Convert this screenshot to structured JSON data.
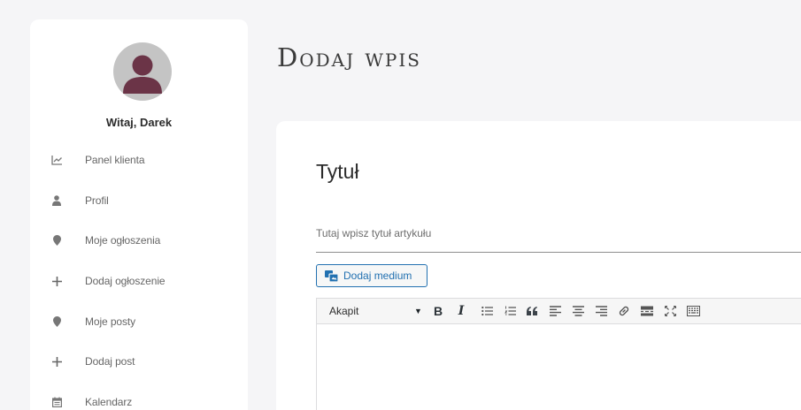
{
  "sidebar": {
    "greeting": "Witaj, Darek",
    "items": [
      {
        "label": "Panel klienta",
        "icon": "chart-line-icon"
      },
      {
        "label": "Profil",
        "icon": "user-icon"
      },
      {
        "label": "Moje ogłoszenia",
        "icon": "map-pin-icon"
      },
      {
        "label": "Dodaj ogłoszenie",
        "icon": "plus-icon"
      },
      {
        "label": "Moje posty",
        "icon": "map-pin-icon"
      },
      {
        "label": "Dodaj post",
        "icon": "plus-icon"
      },
      {
        "label": "Kalendarz",
        "icon": "calendar-icon"
      }
    ]
  },
  "main": {
    "page_title": "Dodaj wpis",
    "section_title": "Tytuł",
    "title_placeholder": "Tutaj wpisz tytuł artykułu",
    "media_button": "Dodaj medium",
    "editor": {
      "format_value": "Akapit",
      "bold_label": "B",
      "italic_label": "I"
    }
  },
  "colors": {
    "accent": "#2271b1",
    "avatar": "#6b3447",
    "background": "#f5f5f7"
  }
}
